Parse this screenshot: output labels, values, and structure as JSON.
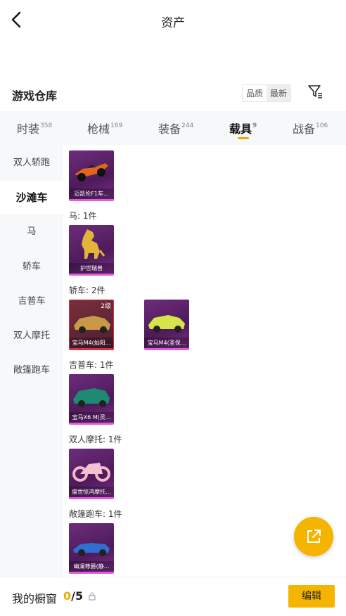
{
  "header": {
    "title": "资产"
  },
  "section": {
    "title": "游戏仓库",
    "sort_quality": "品质",
    "sort_latest": "最新"
  },
  "tabs": [
    {
      "label": "时装",
      "count": "358"
    },
    {
      "label": "枪械",
      "count": "169"
    },
    {
      "label": "装备",
      "count": "244"
    },
    {
      "label": "载具",
      "count": "9"
    },
    {
      "label": "战备",
      "count": "106"
    }
  ],
  "sidebar": [
    "双人轿跑",
    "沙滩车",
    "马",
    "轿车",
    "吉普车",
    "双人摩托",
    "敞篷跑车"
  ],
  "groups": {
    "horse": "马: 1件",
    "sedan": "轿车: 2件",
    "jeep": "吉普车: 1件",
    "moto": "双人摩托: 1件",
    "conv": "敞篷跑车: 1件"
  },
  "items": {
    "f1": "迈凯伦F1车...",
    "horse": "护世瑞兽",
    "bmw_a": "宝马M4(灿阳...",
    "bmw_a_level": "2级",
    "bmw_b": "宝马M4(圣保...",
    "x6": "宝马X6 M(灵...",
    "moto": "盛世惊鸿摩托...",
    "conv": "幽澜尊爵(静..."
  },
  "bottom": {
    "label": "我的橱窗",
    "current": "0",
    "total": "/5",
    "edit": "编辑"
  },
  "colors": {
    "accent": "#f5b400",
    "card_border": "#e05adc",
    "rare_border": "#d9323a"
  },
  "icons": {
    "back": "chevron-left-icon",
    "filter": "filter-icon",
    "lock": "lock-icon",
    "share": "external-link-icon"
  }
}
